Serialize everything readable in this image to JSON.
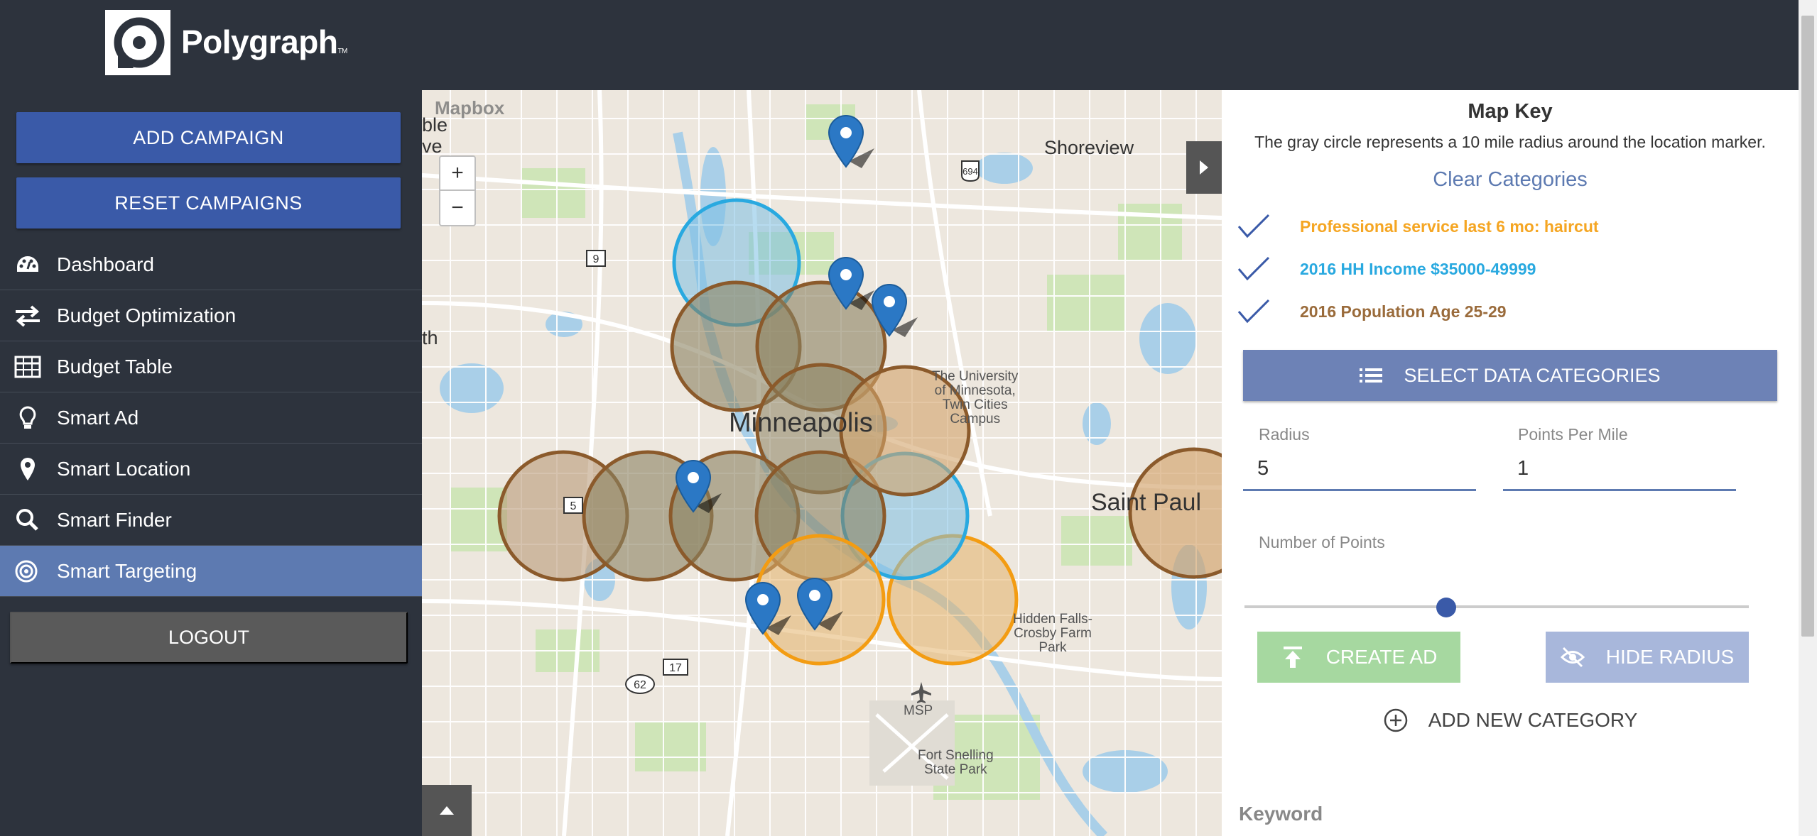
{
  "app": {
    "name": "Polygraph",
    "tm": "TM"
  },
  "sidebar": {
    "add_campaign": "ADD CAMPAIGN",
    "reset_campaigns": "RESET CAMPAIGNS",
    "items": [
      {
        "label": "Dashboard",
        "icon": "dashboard-icon"
      },
      {
        "label": "Budget Optimization",
        "icon": "exchange-icon"
      },
      {
        "label": "Budget Table",
        "icon": "table-icon"
      },
      {
        "label": "Smart Ad",
        "icon": "lightbulb-icon"
      },
      {
        "label": "Smart Location",
        "icon": "map-marker-icon"
      },
      {
        "label": "Smart Finder",
        "icon": "search-icon"
      },
      {
        "label": "Smart Targeting",
        "icon": "target-icon"
      }
    ],
    "active_item": "Smart Targeting",
    "logout": "LOGOUT"
  },
  "map": {
    "attribution": "Mapbox",
    "zoom_in": "+",
    "zoom_out": "−",
    "labels": {
      "minneapolis": "Minneapolis",
      "saint_paul": "Saint Paul",
      "shoreview": "Shoreview",
      "university": "The University\nof Minnesota,\nTwin Cities\nCampus",
      "hidden_falls": "Hidden Falls-\nCrosby Farm\nPark",
      "msp": "MSP",
      "fort_snelling": "Fort Snelling\nState Park",
      "edge_left_1": "ble",
      "edge_left_2": "ve",
      "edge_left_3": "th"
    },
    "shields": [
      "694",
      "9",
      "5",
      "17",
      "62"
    ],
    "colors": {
      "blue": "#29a9e0",
      "brown": "#8b5a2b",
      "orange": "#f39c12",
      "marker": "#2b78c5"
    }
  },
  "panel": {
    "map_key_title": "Map Key",
    "map_key_desc": "The gray circle represents a 10 mile radius around the location marker.",
    "clear_categories": "Clear Categories",
    "categories": [
      {
        "label": "Professional service last 6 mo: haircut",
        "color": "#f5a623"
      },
      {
        "label": "2016 HH Income $35000-49999",
        "color": "#29a9e0"
      },
      {
        "label": "2016 Population Age 25-29",
        "color": "#9a6b3b"
      }
    ],
    "select_data_categories": "SELECT DATA CATEGORIES",
    "radius_label": "Radius",
    "radius_value": "5",
    "points_per_mile_label": "Points Per Mile",
    "points_per_mile_value": "1",
    "number_of_points_label": "Number of Points",
    "number_of_points_fraction": 0.4,
    "create_ad": "CREATE AD",
    "hide_radius": "HIDE RADIUS",
    "add_new_category": "ADD NEW CATEGORY",
    "keyword_label": "Keyword"
  }
}
